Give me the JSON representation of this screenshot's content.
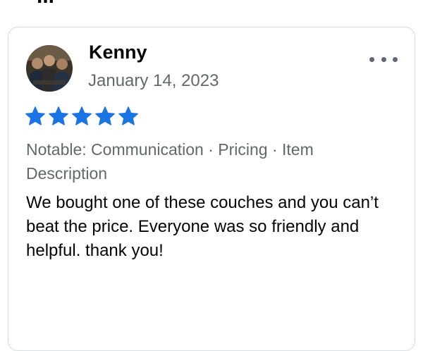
{
  "heading_fragment": "...",
  "review": {
    "author_name": "Kenny",
    "date": "January 14, 2023",
    "rating": 5,
    "rating_max": 5,
    "notable": "Notable: Communication · Pricing · Item Description",
    "text": "We bought one of these couches and you can’t beat the price. Everyone was so friendly and helpful. thank you!",
    "more_icon": "more-options-icon",
    "star_icon": "star-icon",
    "star_color": "#1b74e4",
    "secondary_text_color": "#65676b"
  }
}
